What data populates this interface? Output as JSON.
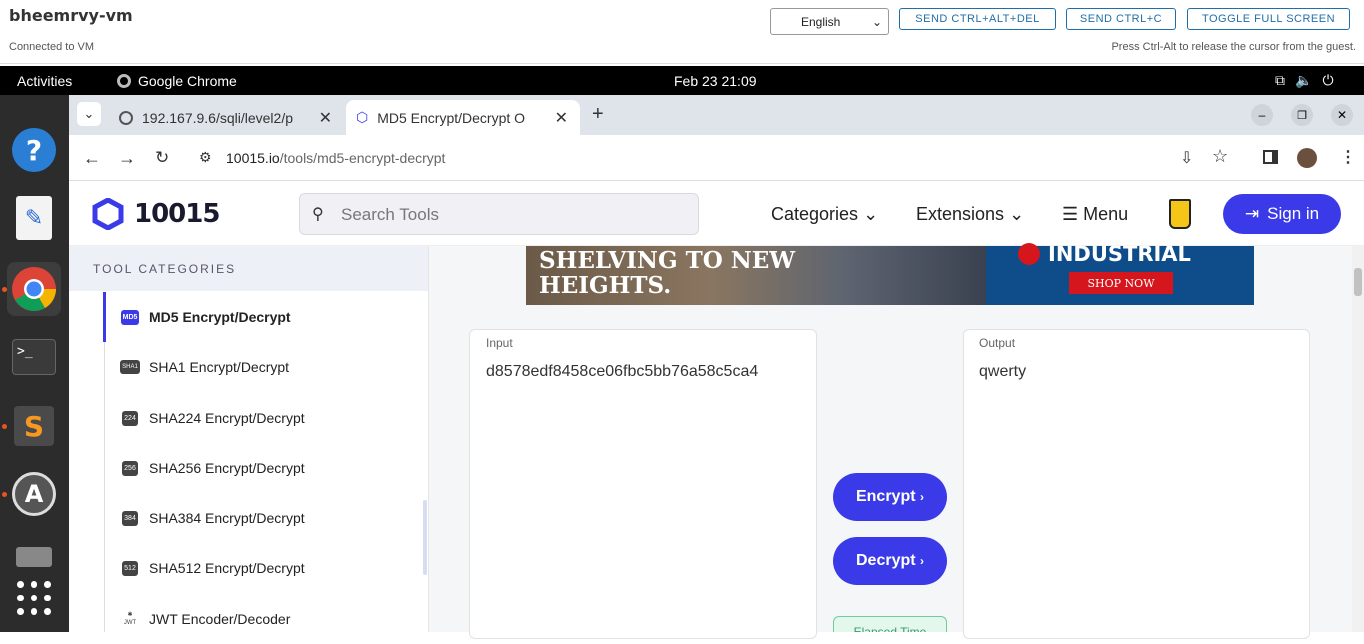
{
  "vm": {
    "name": "bheemrvy-vm",
    "status": "Connected to VM",
    "language": "English",
    "buttons": [
      "SEND CTRL+ALT+DEL",
      "SEND CTRL+C",
      "TOGGLE FULL SCREEN"
    ],
    "hint": "Press Ctrl-Alt to release the cursor from the guest."
  },
  "gnome": {
    "activities": "Activities",
    "app": "Google Chrome",
    "clock": "Feb 23  21:09"
  },
  "browser": {
    "tabs": [
      {
        "title": "192.167.9.6/sqli/level2/p"
      },
      {
        "title": "MD5 Encrypt/Decrypt O"
      }
    ],
    "url_domain": "10015.io",
    "url_path": "/tools/md5-encrypt-decrypt"
  },
  "site": {
    "logo": "10015",
    "search_placeholder": "Search Tools",
    "nav": {
      "categories": "Categories",
      "extensions": "Extensions",
      "menu": "Menu",
      "signin": "Sign in"
    },
    "sidebar_title": "TOOL CATEGORIES",
    "sidebar_items": [
      {
        "label": "MD5 Encrypt/Decrypt",
        "badge": "MD5",
        "active": true
      },
      {
        "label": "SHA1 Encrypt/Decrypt",
        "badge": "SHA1"
      },
      {
        "label": "SHA224 Encrypt/Decrypt",
        "badge": "224"
      },
      {
        "label": "SHA256 Encrypt/Decrypt",
        "badge": "256"
      },
      {
        "label": "SHA384 Encrypt/Decrypt",
        "badge": "384"
      },
      {
        "label": "SHA512 Encrypt/Decrypt",
        "badge": "512"
      },
      {
        "label": "JWT Encoder/Decoder",
        "badge": "JWT"
      }
    ],
    "ad": {
      "left_text_1": "SHELVING TO NEW",
      "left_text_2": "HEIGHTS.",
      "brand": "INDUSTRIAL",
      "cta": "SHOP NOW"
    },
    "input_label": "Input",
    "input_value": "d8578edf8458ce06fbc5bb76a58c5ca4",
    "output_label": "Output",
    "output_value": "qwerty",
    "encrypt": "Encrypt",
    "decrypt": "Decrypt",
    "elapsed": "Elapsed Time"
  },
  "colors": {
    "accent": "#3a3ae8",
    "dock": "#2c2c2c",
    "ubuntu_orange": "#e95420"
  }
}
